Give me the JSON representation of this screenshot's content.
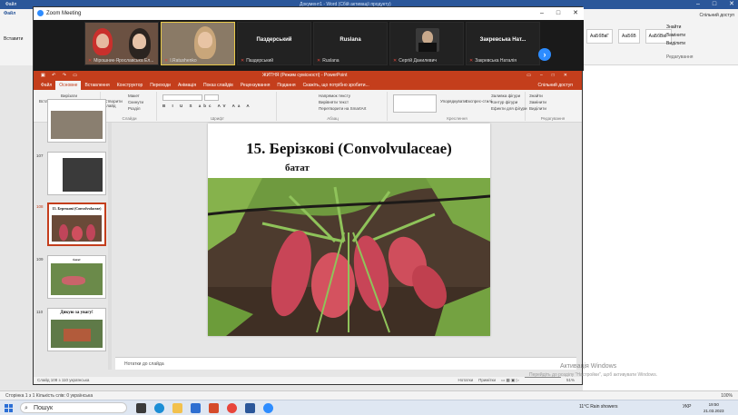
{
  "word": {
    "title_left": "Файл",
    "doc_title": "Документ1 - Word (Сбій активації продукту)",
    "share": "Спільний доступ",
    "paste": "Вставити",
    "styles": [
      "АаБбВвГ",
      "АаБбВ",
      "АаБбВвГ"
    ],
    "edit": [
      "Знайти",
      "Замінити",
      "Виділити"
    ],
    "edit_group": "Редагування",
    "status": "Сторінка 1 з 1   Кількість слів: 0   українська",
    "zoom": "100%"
  },
  "zoom": {
    "title": "Zoom Meeting",
    "participants": [
      {
        "name": "",
        "label": "Мірошник-Ярославська Ел...",
        "type": "video",
        "muted": true
      },
      {
        "name": "",
        "label": "I.Ratushenko",
        "type": "video",
        "muted": true,
        "active": true
      },
      {
        "name": "Паздерський",
        "label": "Паздерський",
        "type": "name",
        "muted": true
      },
      {
        "name": "Ruslana",
        "label": "Ruslana",
        "type": "name",
        "muted": true
      },
      {
        "name": "",
        "label": "Сергій Данилевич",
        "type": "photo",
        "muted": true
      },
      {
        "name": "Закревська Нат...",
        "label": "Закревська Наталія",
        "type": "name",
        "muted": true
      }
    ]
  },
  "ppt": {
    "title": "ЖИТНЯ (Режим сумісності) - PowerPoint",
    "tabs": [
      "Файл",
      "Основне",
      "Вставлення",
      "Конструктор",
      "Переходи",
      "Анімація",
      "Показ слайдів",
      "Рецензування",
      "Подання",
      "Скажіть, що потрібно зробити..."
    ],
    "selected_tab": "Основне",
    "share": "Спільний доступ",
    "ribbon_groups": [
      "Буфер обміну",
      "Слайди",
      "Шрифт",
      "Абзац",
      "Креслення",
      "Редагування"
    ],
    "ribbon_items": {
      "paste": "Вставити",
      "new_slide": "Створити слайд",
      "layout": "Макет",
      "reset": "Скинути",
      "section": "Розділ",
      "cut": "Вирізати",
      "copy": "Копіювати",
      "format": "Формат за зразком",
      "text_dir": "Напрямок тексту",
      "align_text": "Вирівняти текст",
      "smartart": "Перетворити на SmartArt",
      "arrange": "Упорядкувати",
      "quick_styles": "Експрес-стилі",
      "fill": "Заливка фігури",
      "outline": "Контур фігури",
      "effects": "Ефекти для фігури",
      "find": "Знайти",
      "replace": "Замінити",
      "select": "Виділити"
    },
    "thumbs": [
      {
        "num": "",
        "title": ""
      },
      {
        "num": "107",
        "title": ""
      },
      {
        "num": "108",
        "title": "15. Березкові (Convolvulaceae)",
        "selected": true
      },
      {
        "num": "109",
        "title": "батат"
      },
      {
        "num": "110",
        "title": "Дякую за увагу!"
      }
    ],
    "slide": {
      "title": "15. Берізкові (Convolvulaceae)",
      "subtitle": "батат"
    },
    "notes": "Нотатки до слайда",
    "status_left": "Слайд 108 з 110   українська",
    "status_notes": "Нотатки",
    "status_comments": "Примітки",
    "zoom": "51%"
  },
  "activation": {
    "title": "Активація Windows",
    "sub": "Перейдіть до розділу \"Настройки\", щоб активувати Windows."
  },
  "taskbar": {
    "search": "Пошук",
    "weather": "11°C  Rain showers",
    "lang": "УКР",
    "time": "19:50",
    "date": "21.03.2023"
  }
}
